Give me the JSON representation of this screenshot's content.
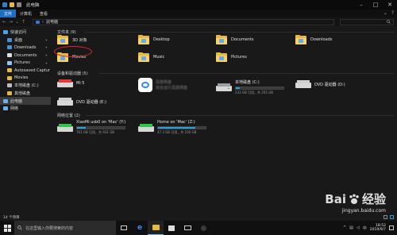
{
  "window": {
    "title": "此电脑"
  },
  "ribbon": {
    "tabs": [
      "文件",
      "计算机",
      "查看"
    ]
  },
  "address": {
    "path": "此电脑"
  },
  "sidebar": {
    "items": [
      {
        "label": "快速访问",
        "indent": false,
        "icon": "star-icon",
        "color": "#4aa3e8",
        "pinned": false
      },
      {
        "label": "桌面",
        "indent": true,
        "icon": "desktop-icon",
        "color": "#4a8fd8",
        "pinned": true
      },
      {
        "label": "Downloads",
        "indent": true,
        "icon": "download-icon",
        "color": "#4a8fd8",
        "pinned": true
      },
      {
        "label": "Documents",
        "indent": true,
        "icon": "document-icon",
        "color": "#e0e0e0",
        "pinned": true
      },
      {
        "label": "Pictures",
        "indent": true,
        "icon": "pictures-icon",
        "color": "#8ec5ff",
        "pinned": true
      },
      {
        "label": "Autosaved Captur",
        "indent": true,
        "icon": "folder-icon",
        "color": "#e8b93a",
        "pinned": false
      },
      {
        "label": "Movies",
        "indent": true,
        "icon": "folder-icon",
        "color": "#e8b93a",
        "pinned": false
      },
      {
        "label": "本地磁盘 (C:)",
        "indent": true,
        "icon": "drive-icon",
        "color": "#bdbdbd",
        "pinned": false
      },
      {
        "label": "其他磁盘",
        "indent": true,
        "icon": "folder-icon",
        "color": "#e8b93a",
        "pinned": false
      },
      {
        "label": "此电脑",
        "indent": false,
        "icon": "computer-icon",
        "color": "#6ab0f0",
        "pinned": false,
        "selected": true
      },
      {
        "label": "网络",
        "indent": false,
        "icon": "network-icon",
        "color": "#6ab0f0",
        "pinned": false
      }
    ]
  },
  "main": {
    "folders_header": "文件夹 (9)",
    "folders": [
      "3D 对象",
      "Desktop",
      "Documents",
      "Downloads",
      "Movies",
      "Music",
      "Pictures"
    ],
    "devices_header": "设备和驱动器 (5)",
    "devices": {
      "mi": {
        "name": "Mi 5"
      },
      "cloud": {
        "name": "百度网盘",
        "sub": "双击运行百度网盘"
      },
      "local_c": {
        "name": "本地磁盘 (C:)",
        "free": "233 GB 可用，共 255 GB",
        "used_fraction": 0.09
      },
      "dvd1": {
        "name": "DVD 驱动器 (D:)"
      },
      "dvd2": {
        "name": "DVD 驱动器 (E:)"
      }
    },
    "network_header": "网络位置 (2)",
    "network": [
      {
        "name": "XiaoMi usb0 on 'Mac' (Y:)",
        "free": "761 GB 可用，共 931 GB",
        "used_fraction": 0.18
      },
      {
        "name": "Home on 'Mac' (Z:)",
        "free": "47.3 GB 可用，共 230 GB",
        "used_fraction": 0.79
      }
    ]
  },
  "status": {
    "count": "14 个项目"
  },
  "taskbar": {
    "search_placeholder": "在这里输入你要搜索的内容",
    "time": "18:52",
    "date": "2019/9/7"
  },
  "watermark": {
    "brand": "Bai",
    "brand2": "经验",
    "url": "jingyan.baidu.com"
  }
}
